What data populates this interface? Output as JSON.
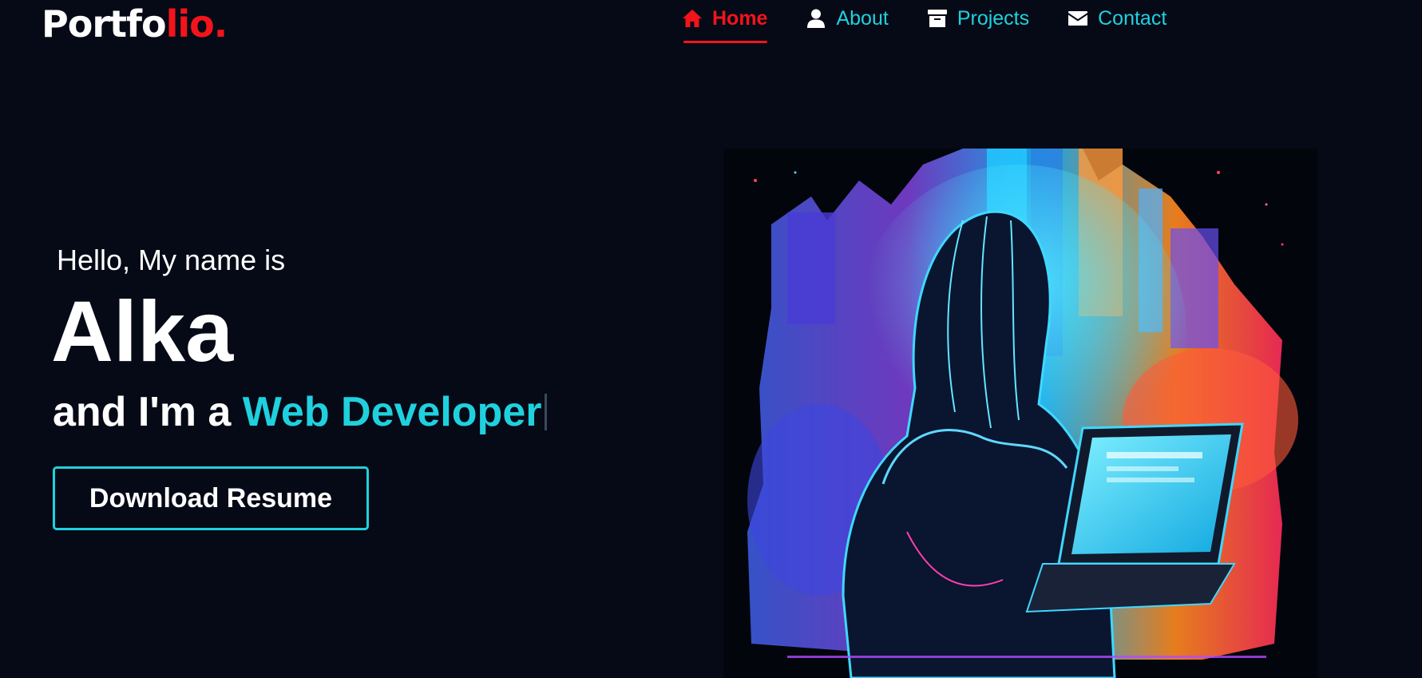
{
  "header": {
    "logo_main": "Portfo",
    "logo_accent": "lio."
  },
  "nav": {
    "items": [
      {
        "label": "Home",
        "icon": "home-icon",
        "active": true
      },
      {
        "label": "About",
        "icon": "user-icon",
        "active": false
      },
      {
        "label": "Projects",
        "icon": "archive-icon",
        "active": false
      },
      {
        "label": "Contact",
        "icon": "envelope-icon",
        "active": false
      }
    ]
  },
  "hero": {
    "greeting": "Hello, My name is",
    "name": "Alka",
    "role_prefix": "and I'm a ",
    "role": "Web Developer",
    "button_label": "Download Resume"
  },
  "colors": {
    "background": "#060a16",
    "accent_red": "#f3141b",
    "accent_cyan": "#1fd1de",
    "text": "#ffffff"
  }
}
